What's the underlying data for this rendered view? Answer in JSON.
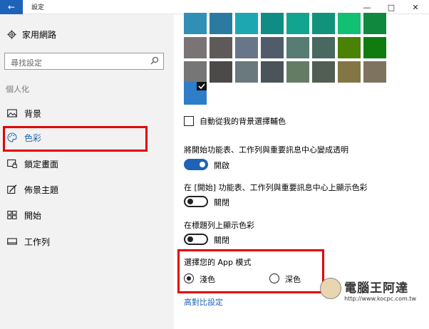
{
  "window": {
    "title": "設定"
  },
  "sidebar": {
    "home_label": "家用網路",
    "search_placeholder": "尋找設定",
    "section_title": "個人化",
    "items": [
      {
        "label": "背景",
        "icon": "image-icon"
      },
      {
        "label": "色彩",
        "icon": "palette-icon",
        "active": true
      },
      {
        "label": "鎖定畫面",
        "icon": "lock-screen-icon"
      },
      {
        "label": "佈景主題",
        "icon": "brush-icon"
      },
      {
        "label": "開始",
        "icon": "start-grid-icon"
      },
      {
        "label": "工作列",
        "icon": "taskbar-icon"
      }
    ]
  },
  "main": {
    "color_swatches": [
      [
        "#2f8fb4",
        "#2b7ba0",
        "#1da8b1",
        "#0e8c85",
        "#11a48e",
        "#10937a",
        "#11c073",
        "#10893e"
      ],
      [
        "#7a7574",
        "#5d5a58",
        "#68768a",
        "#515c6b",
        "#567c73",
        "#486860",
        "#498205",
        "#107c10"
      ],
      [
        "#767676",
        "#4c4a48",
        "#69797e",
        "#4a5459",
        "#647c64",
        "#525e54",
        "#847545",
        "#7e735f"
      ]
    ],
    "selected_color": "#2d7dc8",
    "auto_color_label": "自動從我的背景選擇輔色",
    "transparency_label": "將開始功能表、工作列與重要訊息中心變成透明",
    "transparency_state": "開啟",
    "start_color_label": "在 [開始] 功能表、工作列與重要訊息中心上顯示色彩",
    "start_color_state": "關閉",
    "titlebar_color_label": "在標題列上顯示色彩",
    "titlebar_color_state": "關閉",
    "app_mode_title": "選擇您的 App 模式",
    "app_mode_light": "淺色",
    "app_mode_dark": "深色",
    "high_contrast_link": "高對比設定"
  },
  "watermark": {
    "title": "電腦王阿達",
    "url": "http://www.kocpc.com.tw"
  }
}
